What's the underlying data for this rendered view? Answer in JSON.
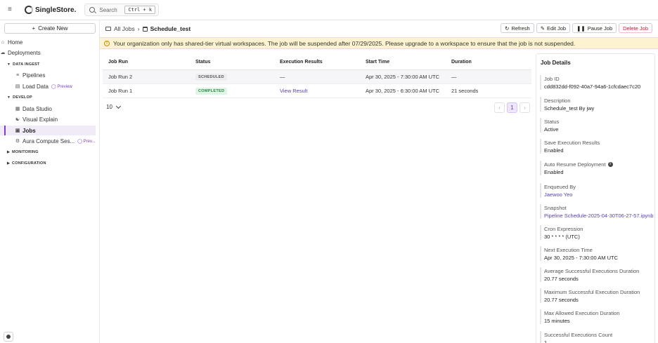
{
  "topbar": {
    "logo_text": "SingleStore.",
    "search_label": "Search",
    "search_shortcut": "Ctrl + k"
  },
  "sidebar": {
    "create_label": "Create New",
    "home": "Home",
    "deployments": "Deployments",
    "section_data_ingest": "DATA INGEST",
    "pipelines": "Pipelines",
    "load_data": "Load Data",
    "preview_label": "Preview",
    "preview_short": "Prev...",
    "section_develop": "DEVELOP",
    "data_studio": "Data Studio",
    "visual_explain": "Visual Explain",
    "jobs": "Jobs",
    "aura_compute": "Aura Compute Ses...",
    "section_monitoring": "MONITORING",
    "section_configuration": "CONFIGURATION"
  },
  "breadcrumb": {
    "root": "All Jobs",
    "current": "Schedule_test"
  },
  "actions": {
    "refresh": "Refresh",
    "edit": "Edit Job",
    "pause": "Pause Job",
    "delete": "Delete Job"
  },
  "banner": {
    "text": "Your organization only has shared-tier virtual workspaces. The job will be suspended after 07/29/2025. Please upgrade to a workspace to ensure that the job is not suspended."
  },
  "table": {
    "headers": [
      "Job Run",
      "Status",
      "Execution Results",
      "Start Time",
      "Duration"
    ],
    "rows": [
      {
        "run": "Job Run 2",
        "status": "SCHEDULED",
        "results": "—",
        "start": "Apr 30, 2025 - 7:30:00 AM UTC",
        "duration": "—"
      },
      {
        "run": "Job Run 1",
        "status": "COMPLETED",
        "results": "View Result",
        "start": "Apr 30, 2025 - 6:30:00 AM UTC",
        "duration": "21 seconds"
      }
    ],
    "page_size": "10",
    "current_page": "1"
  },
  "details": {
    "title": "Job Details",
    "fields": [
      {
        "label": "Job ID",
        "value": "cdd832dd-f092-40a7-94a6-1cfcdaec7c20"
      },
      {
        "label": "Description",
        "value": "Schedule_test By jwy"
      },
      {
        "label": "Status",
        "value": "Active"
      },
      {
        "label": "Save Execution Results",
        "value": "Enabled"
      },
      {
        "label": "Auto Resume Deployment",
        "value": "Enabled"
      },
      {
        "label": "Enqueued By",
        "value": "Jaewoo Yeo"
      },
      {
        "label": "Snapshot",
        "value": "Pipeline Schedule-2025-04-30T06-27-57.ipynb"
      },
      {
        "label": "Cron Expression",
        "value": "30 * * * * (UTC)"
      },
      {
        "label": "Next Execution Time",
        "value": "Apr 30, 2025 - 7:30:00 AM UTC"
      },
      {
        "label": "Average Successful Executions Duration",
        "value": "20.77 seconds"
      },
      {
        "label": "Maximum Successful Execution Duration",
        "value": "20.77 seconds"
      },
      {
        "label": "Max Allowed Execution Duration",
        "value": "15 minutes"
      },
      {
        "label": "Successful Executions Count",
        "value": "1"
      }
    ]
  },
  "colors": {
    "accent": "#7b3fc9",
    "danger": "#c21e3a",
    "banner_bg": "#fdf3d0"
  }
}
